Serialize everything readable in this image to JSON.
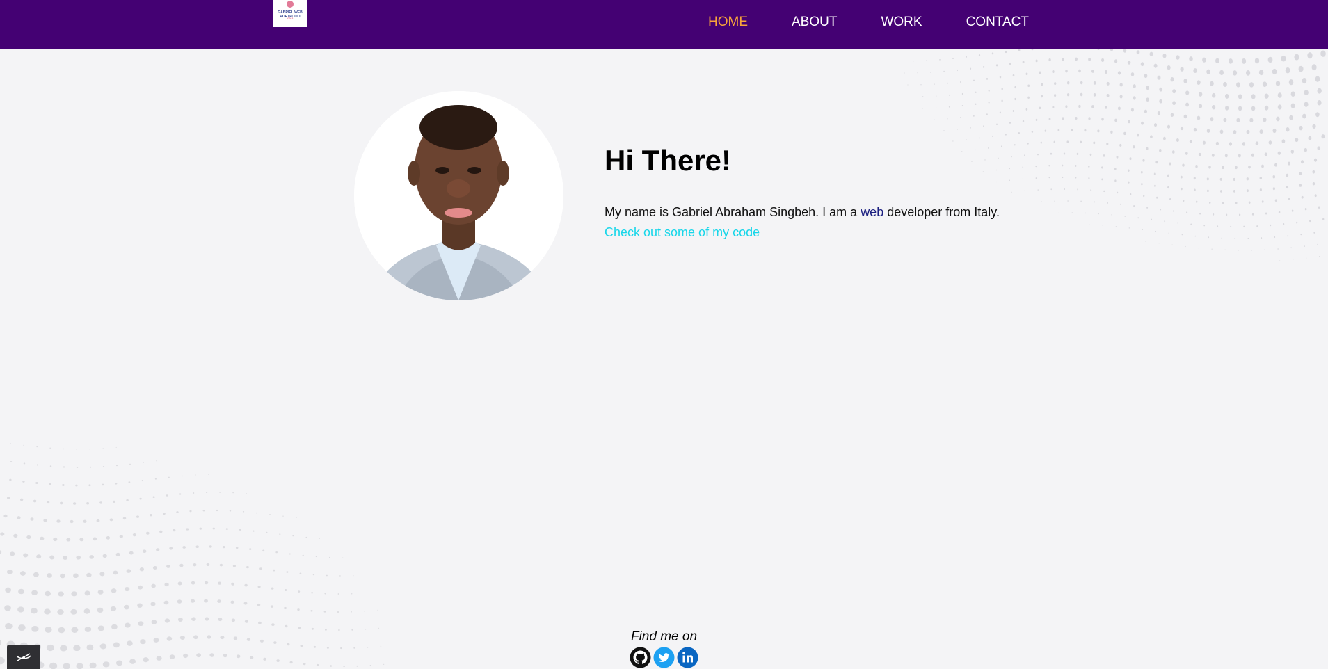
{
  "header": {
    "logo": {
      "line1": "GABRIEL WEB PORTFOLIO",
      "line2": "2021"
    },
    "nav": [
      {
        "label": "HOME",
        "active": true
      },
      {
        "label": "ABOUT",
        "active": false
      },
      {
        "label": "WORK",
        "active": false
      },
      {
        "label": "CONTACT",
        "active": false
      }
    ]
  },
  "hero": {
    "title": "Hi There!",
    "intro_before": "My name is Gabriel Abraham Singbeh. I am a ",
    "intro_highlight": "web",
    "intro_after": " developer from Italy.",
    "code_link": "Check out some of my code"
  },
  "footer": {
    "label": "Find me on",
    "social": [
      "github-icon",
      "twitter-icon",
      "linkedin-icon"
    ]
  },
  "colors": {
    "nav_background": "#440173",
    "nav_active": "#f9a43b",
    "link_cyan": "#17d6e9",
    "highlight_navy": "#1b1f80",
    "page_background": "#f4f4f6",
    "twitter": "#1da1f2",
    "linkedin": "#0a66c2"
  }
}
